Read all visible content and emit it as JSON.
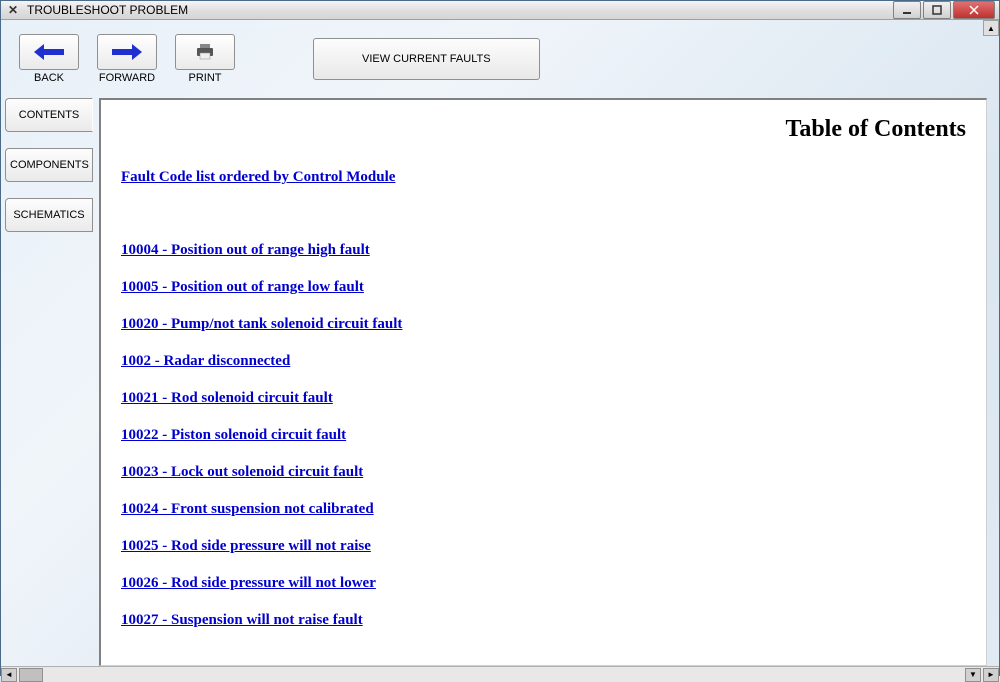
{
  "window": {
    "title": "TROUBLESHOOT PROBLEM"
  },
  "toolbar": {
    "back_label": "BACK",
    "forward_label": "FORWARD",
    "print_label": "PRINT",
    "view_faults_label": "VIEW CURRENT FAULTS"
  },
  "tabs": {
    "contents": "CONTENTS",
    "components": "COMPONENTS",
    "schematics": "SCHEMATICS"
  },
  "content": {
    "page_title": "Table of Contents",
    "header_link": "Fault Code list ordered by Control Module",
    "fault_links": [
      "10004 - Position out of range high fault",
      "10005 - Position out of range low fault",
      "10020 - Pump/not tank solenoid circuit fault",
      "1002 - Radar disconnected",
      "10021 - Rod solenoid circuit fault",
      "10022 - Piston solenoid circuit fault",
      "10023 - Lock out solenoid circuit fault",
      "10024 - Front suspension not calibrated",
      "10025 - Rod side pressure will not raise",
      "10026 - Rod side pressure will not lower",
      "10027 - Suspension will not raise fault"
    ]
  }
}
